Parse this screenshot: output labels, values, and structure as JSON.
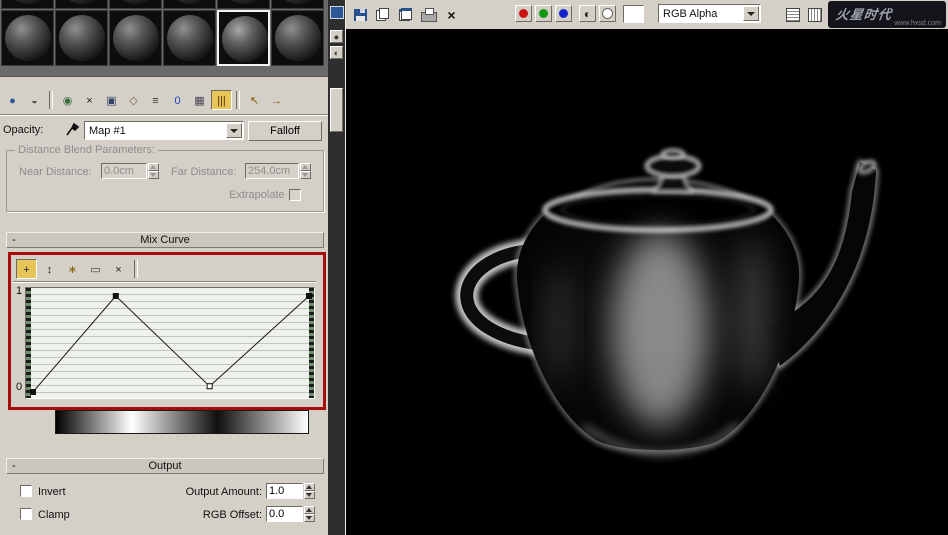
{
  "material_editor": {
    "sample_slots": {
      "cols": 6,
      "selected_index": 4
    },
    "toolbar_icons": [
      {
        "name": "get-material",
        "glyph": "●",
        "color": "#2b5797"
      },
      {
        "name": "put-material-to-scene",
        "glyph": "◒",
        "color": "#555555"
      },
      {
        "sep": true
      },
      {
        "name": "assign-material-to-selection",
        "glyph": "◉",
        "color": "#3a6b3a"
      },
      {
        "name": "reset-map",
        "glyph": "×",
        "color": "#1a1a1a"
      },
      {
        "name": "make-material-copy",
        "glyph": "▣",
        "color": "#334466"
      },
      {
        "name": "make-unique",
        "glyph": "◇",
        "color": "#776644"
      },
      {
        "name": "put-to-library",
        "glyph": "≡",
        "color": "#333333"
      },
      {
        "name": "material-id-channel",
        "glyph": "0",
        "color": "#1b3fbf"
      },
      {
        "name": "show-map-in-viewport",
        "glyph": "▦",
        "color": "#444455"
      },
      {
        "name": "show-end-result",
        "glyph": "|||",
        "color": "#553300",
        "pressed": true
      },
      {
        "sep": true
      },
      {
        "name": "go-to-parent",
        "glyph": "↖",
        "color": "#885500"
      },
      {
        "name": "go-forward-sibling",
        "glyph": "→",
        "color": "#885500"
      }
    ],
    "opacity_label": "Opacity:",
    "map_button": "Map #1",
    "falloff_button": "Falloff",
    "distance_params": {
      "title": "Distance Blend Parameters:",
      "near_label": "Near Distance:",
      "near_value": "0.0cm",
      "far_label": "Far Distance:",
      "far_value": "254.0cm",
      "extrapolate_label": "Extrapolate"
    },
    "mix_curve": {
      "title": "Mix Curve",
      "collapse": "-",
      "toolbar_icons": [
        {
          "name": "move-point",
          "glyph": "+",
          "color": "#222222",
          "pressed": true
        },
        {
          "name": "scale-point",
          "glyph": "↕",
          "color": "#222222"
        },
        {
          "name": "add-point",
          "glyph": "∗",
          "color": "#806000"
        },
        {
          "name": "delete-point",
          "glyph": "▭",
          "color": "#444444"
        },
        {
          "name": "reset-curve",
          "glyph": "×",
          "color": "#1a1a1a"
        },
        {
          "sep": true
        }
      ]
    },
    "output": {
      "title": "Output",
      "collapse": "-",
      "invert_label": "Invert",
      "amount_label": "Output Amount:",
      "amount_value": "1.0",
      "clamp_label": "Clamp",
      "rgb_offset_label": "RGB Offset:",
      "rgb_offset_value": "0.0"
    }
  },
  "chart_data": {
    "type": "line",
    "title": "Mix Curve",
    "xlabel": "",
    "ylabel": "",
    "x_range": [
      0,
      1
    ],
    "y_range": [
      0,
      1
    ],
    "y_ticks": [
      "1",
      "0"
    ],
    "grid": "horizontal",
    "points": [
      {
        "x": 0.0,
        "y": 0.0,
        "marker": "filled"
      },
      {
        "x": 0.3,
        "y": 1.0,
        "marker": "filled"
      },
      {
        "x": 0.64,
        "y": 0.06,
        "marker": "open"
      },
      {
        "x": 1.0,
        "y": 1.0,
        "marker": "filled"
      }
    ]
  },
  "render_window": {
    "channel_dropdown": "RGB Alpha",
    "logo_title": "火星时代",
    "logo_url": "www.hxsd.com",
    "toolbar_icon_names": [
      "save-image",
      "copy-image",
      "clone-rendered-frame",
      "print-image",
      "clear",
      "red-channel",
      "green-channel",
      "blue-channel",
      "monochrome-channel",
      "alpha-channel",
      "background-color-swatch",
      "channel-dropdown",
      "layout-a",
      "layout-b"
    ]
  }
}
